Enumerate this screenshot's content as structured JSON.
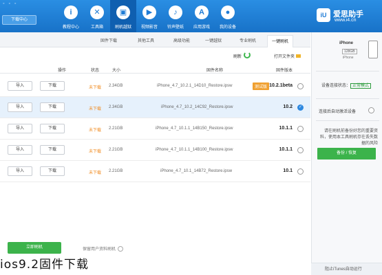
{
  "topbar": {
    "download_center": "下载中心",
    "nav": [
      {
        "label": "我的设备",
        "icon": "user-icon",
        "glyph": "●"
      },
      {
        "label": "应用游戏",
        "icon": "app-store-icon",
        "glyph": "A"
      },
      {
        "label": "铃声壁纸",
        "icon": "bell-icon",
        "glyph": "♪"
      },
      {
        "label": "视频影音",
        "icon": "film-icon",
        "glyph": "▶"
      },
      {
        "label": "刷机越狱",
        "icon": "box-icon",
        "glyph": "▣"
      },
      {
        "label": "工具箱",
        "icon": "tools-icon",
        "glyph": "✕"
      },
      {
        "label": "教程中心",
        "icon": "info-icon",
        "glyph": "i"
      }
    ],
    "brand_name": "爱思助手",
    "brand_url": "www.i4.cn",
    "brand_logo": "iU"
  },
  "tabs": {
    "one_click": "一键刷机",
    "pro": "专业刷机",
    "jailbreak": "一键越狱",
    "advanced": "高级功能",
    "other": "其他工具",
    "firmware": "固件下载"
  },
  "toolbar": {
    "open_folder": "打开文件夹",
    "refresh": "刷新"
  },
  "table": {
    "headers": [
      "固件版本",
      "固件名称",
      "大小",
      "状态",
      "操作"
    ],
    "rows": [
      {
        "version": "10.2.1beta",
        "tag": "测试版",
        "name": "iPhone_4.7_10.2.1_14D10_Restore.ipsw",
        "size": "2.34GB",
        "status": "未下载",
        "download": "下载",
        "import": "导入",
        "selected": false
      },
      {
        "version": "10.2",
        "tag": "",
        "name": "iPhone_4.7_10.2_14C92_Restore.ipsw",
        "size": "2.34GB",
        "status": "未下载",
        "download": "下载",
        "import": "导入",
        "selected": true
      },
      {
        "version": "10.1.1",
        "tag": "",
        "name": "iPhone_4.7_10.1.1_14B150_Restore.ipsw",
        "size": "2.21GB",
        "status": "未下载",
        "download": "下载",
        "import": "导入",
        "selected": false
      },
      {
        "version": "10.1.1",
        "tag": "",
        "name": "iPhone_4.7_10.1.1_14B100_Restore.ipsw",
        "size": "2.21GB",
        "status": "未下载",
        "download": "下载",
        "import": "导入",
        "selected": false
      },
      {
        "version": "10.1",
        "tag": "",
        "name": "iPhone_4.7_10.1_14B72_Restore.ipsw",
        "size": "2.21GB",
        "status": "未下载",
        "download": "下载",
        "import": "导入",
        "selected": false
      }
    ]
  },
  "bottom": {
    "flash_button": "立即刷机",
    "retain_data": "保留用户资料刷机"
  },
  "right_panel": {
    "device_name": "iPhone",
    "capacity": "128GB",
    "model": "iPhone",
    "connection_label": "设备连接状态：",
    "connection_value": "正常模式",
    "restore_label": "连接后自动激活设备",
    "note": "请在刷机前备份好您的重要资料，使用本工具刷机存在丢失数据的风险",
    "backup_button": "备份 / 恢复",
    "footer": "阻止iTunes自动运行"
  },
  "caption": "ios9.2固件下载"
}
